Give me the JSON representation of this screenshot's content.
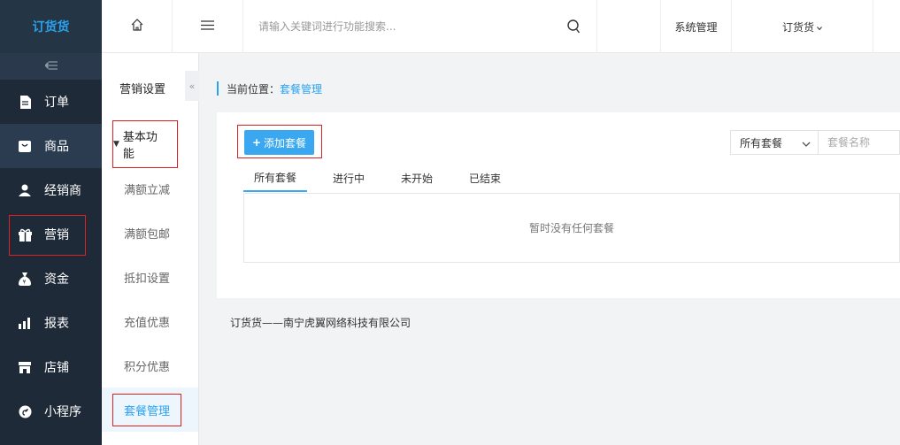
{
  "sidebar": {
    "logo": "订货货",
    "collapse_icon": "collapse-list-icon",
    "items": [
      {
        "label": "订单",
        "icon": "document-icon"
      },
      {
        "label": "商品",
        "icon": "shopping-bag-icon"
      },
      {
        "label": "经销商",
        "icon": "user-icon"
      },
      {
        "label": "营销",
        "icon": "gift-icon"
      },
      {
        "label": "资金",
        "icon": "money-bag-icon"
      },
      {
        "label": "报表",
        "icon": "bar-chart-icon"
      },
      {
        "label": "店铺",
        "icon": "store-icon"
      },
      {
        "label": "小程序",
        "icon": "mini-program-icon"
      }
    ]
  },
  "submenu": {
    "title": "营销设置",
    "toggle": "«",
    "group": "基本功能",
    "items": [
      "满额立减",
      "满额包邮",
      "抵扣设置",
      "充值优惠",
      "积分优惠",
      "套餐管理"
    ]
  },
  "topbar": {
    "search_placeholder": "请输入关键词进行功能搜索...",
    "system": "系统管理",
    "user": "订货货"
  },
  "breadcrumb": {
    "prefix": "当前位置：",
    "current": "套餐管理"
  },
  "main": {
    "add_button": "添加套餐",
    "filter_select": "所有套餐",
    "filter_placeholder": "套餐名称",
    "tabs": [
      "所有套餐",
      "进行中",
      "未开始",
      "已结束"
    ],
    "empty_text": "暂时没有任何套餐"
  },
  "footer": "订货货——南宁虎翼网络科技有限公司",
  "colors": {
    "accent": "#29a3f0",
    "sidebar_bg": "#1f2a38",
    "highlight_border": "#e02020"
  }
}
